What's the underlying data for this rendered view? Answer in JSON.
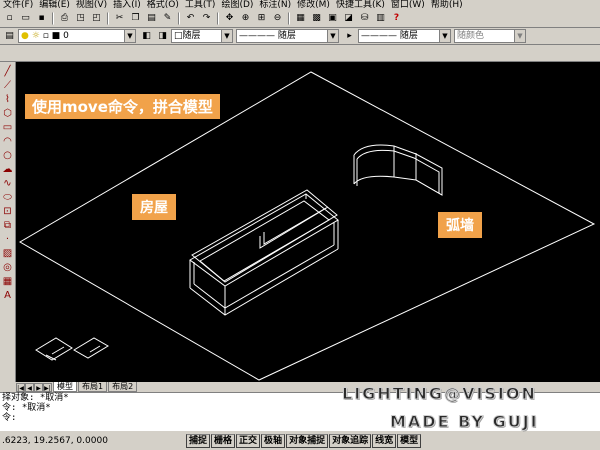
{
  "menu": {
    "items": [
      "文件(F)",
      "编辑(E)",
      "视图(V)",
      "插入(I)",
      "格式(O)",
      "工具(T)",
      "绘图(D)",
      "标注(N)",
      "修改(M)",
      "快捷工具(K)",
      "窗口(W)",
      "帮助(H)"
    ]
  },
  "toolbar2": {
    "layer_value": "0",
    "color_value": "□随层",
    "linetype_value": "———— 随层",
    "lineweight_value": "———— 随层",
    "plotstyle_value": "随颜色"
  },
  "viewport": {
    "caption_main": "使用move命令，拼合模型",
    "label_house": "房屋",
    "label_wall": "弧墙",
    "colors": {
      "background": "#000000",
      "lines": "#ffffff",
      "label_bg": "#f1a24a"
    }
  },
  "tabs": {
    "items": [
      "模型",
      "布局1",
      "布局2"
    ]
  },
  "command": {
    "lines": [
      "择对象: *取消*",
      "令: *取消*",
      "令:"
    ]
  },
  "status": {
    "coords": ".6223, 19.2567, 0.0000",
    "buttons": [
      "捕捉",
      "栅格",
      "正交",
      "极轴",
      "对象捕捉",
      "对象追踪",
      "线宽",
      "模型"
    ]
  },
  "watermark": {
    "line1": "LIGHTING@VISION",
    "line2": "MADE BY GUJI"
  }
}
